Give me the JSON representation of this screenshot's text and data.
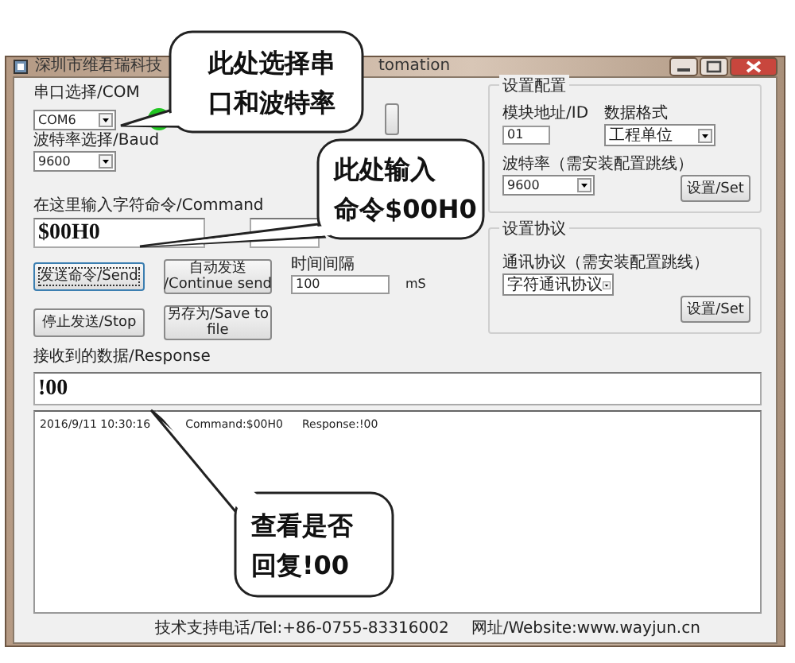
{
  "window": {
    "title_left": "深圳市维君瑞科技",
    "title_right": "tomation"
  },
  "serial": {
    "com_label": "串口选择/COM",
    "com_value": "COM6",
    "baud_label": "波特率选择/Baud",
    "baud_value": "9600",
    "connected": true
  },
  "command": {
    "label": "在这里输入字符命令/Command",
    "value": "$00H0"
  },
  "buttons": [
    {
      "label": "发送命令/Send",
      "focused": true
    },
    {
      "label": "自动发送\n/Continue send",
      "focused": false
    },
    {
      "label": "停止发送/Stop",
      "focused": false
    },
    {
      "label": "另存为/Save to\nfile",
      "focused": false
    }
  ],
  "interval": {
    "label": "时间间隔",
    "value": "100",
    "unit": "mS"
  },
  "config": {
    "title": "设置配置",
    "address_label": "模块地址/ID",
    "address_value": "01",
    "format_label": "数据格式",
    "format_value": "工程单位",
    "baud_label": "波特率（需安装配置跳线）",
    "baud_value": "9600",
    "set_button": "设置/Set"
  },
  "protocol": {
    "title": "设置协议",
    "label": "通讯协议（需安装配置跳线）",
    "value": "字符通讯协议",
    "set_button": "设置/Set"
  },
  "response": {
    "label": "接收到的数据/Response",
    "value": "!00",
    "log": [
      {
        "time": "2016/9/11 10:30:16",
        "command": "Command:$00H0",
        "response": "Response:!00"
      }
    ]
  },
  "footer": {
    "tel": "技术支持电话/Tel:+86-0755-83316002",
    "website": "网址/Website:www.wayjun.cn"
  },
  "callouts": [
    {
      "lines": [
        "此处选择串",
        "口和波特率"
      ]
    },
    {
      "lines": [
        "此处输入",
        "命令$00H0"
      ]
    },
    {
      "lines": [
        "查看是否",
        "回复!00"
      ]
    }
  ]
}
